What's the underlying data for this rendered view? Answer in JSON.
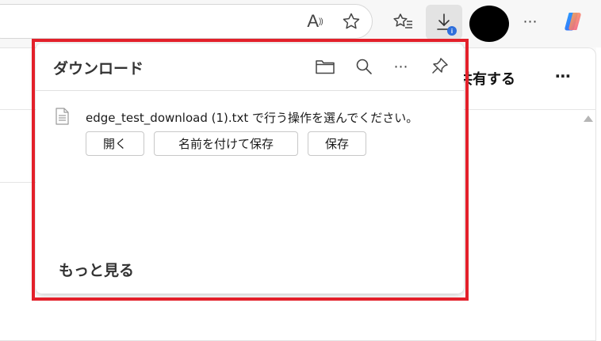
{
  "toolbar": {
    "read_aloud_icon": "read-aloud-icon",
    "favorite_icon": "star-icon",
    "favorites_icon": "favorites-icon",
    "downloads_icon": "download-icon",
    "more_label": "⋯",
    "copilot_icon": "copilot-icon",
    "badge_glyph": "i"
  },
  "page": {
    "share_label": "共有する",
    "more_label": "⋯"
  },
  "download_panel": {
    "title": "ダウンロード",
    "header_icons": [
      "folder-icon",
      "search-icon",
      "more-icon",
      "pin-icon"
    ],
    "more_label": "⋯",
    "item": {
      "message": "edge_test_download (1).txt で行う操作を選んでください。",
      "file_icon": "text-file-icon",
      "actions": {
        "open": "開く",
        "save_as": "名前を付けて保存",
        "save": "保存"
      }
    },
    "see_more": "もっと見る"
  },
  "colors": {
    "highlight": "#e3202a",
    "badge": "#2f6fdb"
  }
}
